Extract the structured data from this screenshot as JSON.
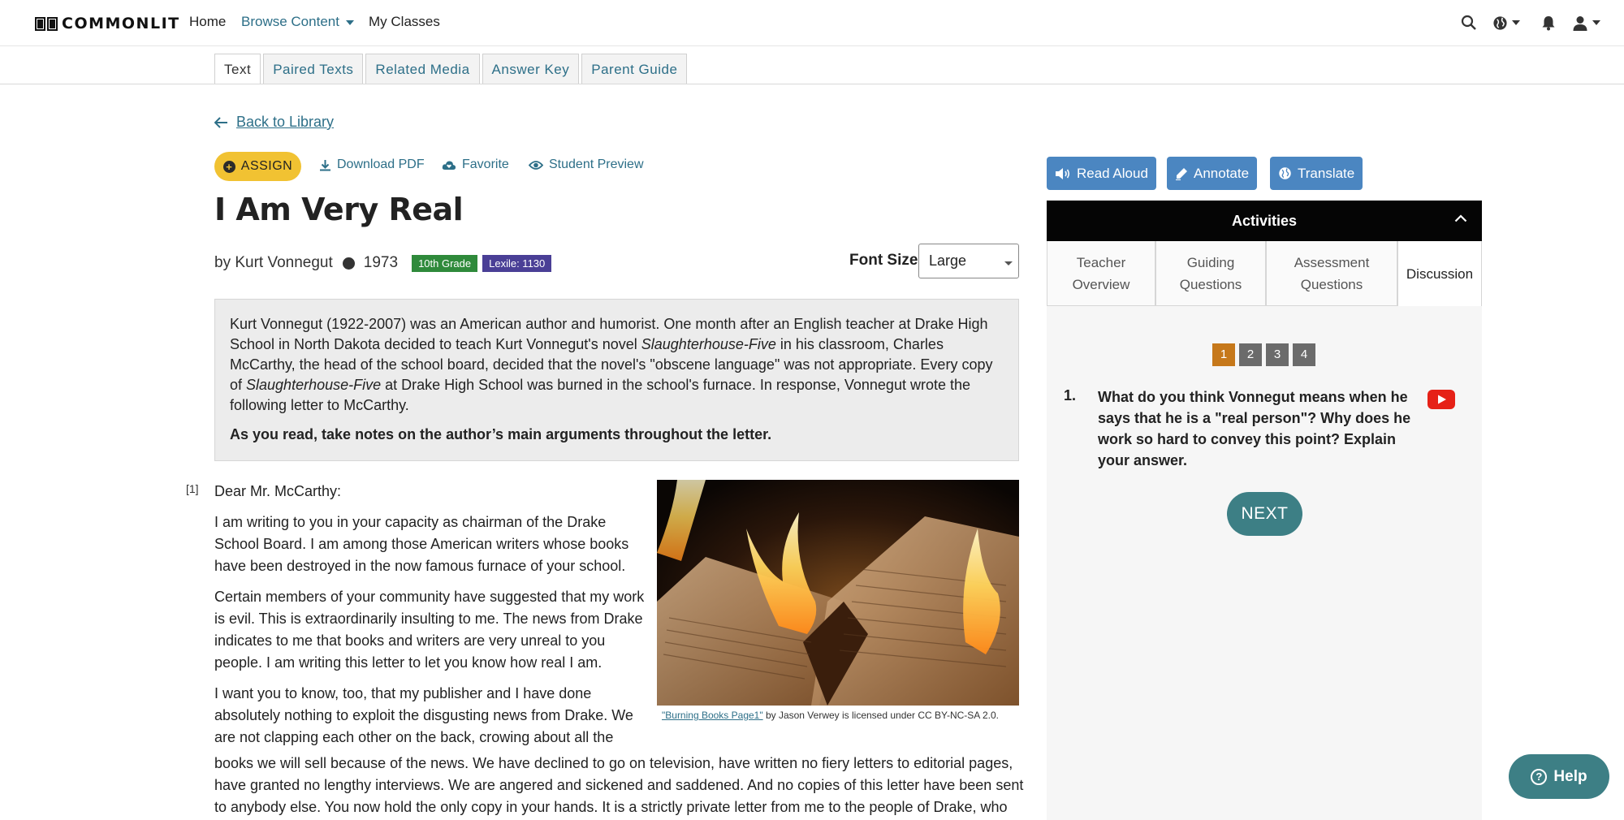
{
  "nav": {
    "logo_text": "COMMONLIT",
    "home": "Home",
    "browse": "Browse Content",
    "classes": "My Classes"
  },
  "tabs": [
    {
      "label": "Text",
      "active": true
    },
    {
      "label": "Paired Texts"
    },
    {
      "label": "Related Media"
    },
    {
      "label": "Answer Key"
    },
    {
      "label": "Parent Guide"
    }
  ],
  "back_link": "Back to Library",
  "actions": {
    "assign": "ASSIGN",
    "download": "Download PDF",
    "favorite": "Favorite",
    "preview": "Student Preview"
  },
  "text": {
    "title": "I Am Very Real",
    "byline": "by Kurt Vonnegut",
    "year": "1973",
    "grade": "10th Grade",
    "lexile": "Lexile: 1130"
  },
  "font_size": {
    "label": "Font Size",
    "selected": "Large"
  },
  "intro": {
    "p1_a": "Kurt Vonnegut (1922-2007) was an American author and humorist. One month after an English teacher at Drake High School in North Dakota decided to teach Kurt Vonnegut's novel ",
    "p1_em1": "Slaughterhouse-Five",
    "p1_b": " in his classroom, Charles McCarthy, the head of the school board, decided that the novel's \"obscene language\" was not appropriate. Every copy of ",
    "p1_em2": "Slaughterhouse-Five",
    "p1_c": " at Drake High School was burned in the school's furnace. In response, Vonnegut wrote the following letter to McCarthy.",
    "note": "As you read, take notes on the author’s main arguments throughout the letter."
  },
  "letter": {
    "para_num": "[1]",
    "salutation": "Dear Mr. McCarthy:",
    "p1": "I am writing to you in your capacity as chairman of the Drake School Board. I am among those American writers whose books have been destroyed in the now famous furnace of your school.",
    "p2": "Certain members of your community have suggested that my work is evil. This is extraordinarily insulting to me. The news from Drake indicates to me that books and writers are very unreal to you people. I am writing this letter to let you know how real I am.",
    "p3_narrow": "I want you to know, too, that my publisher and I have done absolutely nothing to exploit the disgusting news from Drake. We are not clapping each other on the back, crowing about all the",
    "p3_wide": "books we will sell because of the news. We have declined to go on television, have written no fiery letters to editorial pages, have granted no lengthy interviews. We are angered and sickened and saddened. And no copies of this letter have been sent to anybody else. You now hold the only copy in your hands. It is a strictly private letter from me to the people of Drake, who"
  },
  "image": {
    "caption_link": "\"Burning Books Page1\"",
    "caption_rest": " by Jason Verwey is licensed under CC BY-NC-SA 2.0."
  },
  "tools": {
    "read_aloud": "Read Aloud",
    "annotate": "Annotate",
    "translate": "Translate",
    "color": "#4b86c1"
  },
  "activities": {
    "header": "Activities",
    "tabs": [
      {
        "line1": "Teacher",
        "line2": "Overview"
      },
      {
        "line1": "Guiding",
        "line2": "Questions"
      },
      {
        "line1": "Assessment",
        "line2": "Questions"
      },
      {
        "line1": "Discussion",
        "line2": "",
        "active": true
      }
    ],
    "pages": [
      "1",
      "2",
      "3",
      "4"
    ],
    "question_num": "1.",
    "question": "What do you think Vonnegut means when he says that he is a \"real person\"? Why does he work so hard to convey this point? Explain your answer.",
    "next": "NEXT"
  },
  "help": "Help",
  "colors": {
    "brand_teal": "#2d6f88",
    "assign_yellow": "#f1c232",
    "grade_green": "#2f8a3b",
    "lexile_purple": "#4a3f96",
    "active_page": "#c6781a",
    "next_teal": "#3d7f85"
  }
}
